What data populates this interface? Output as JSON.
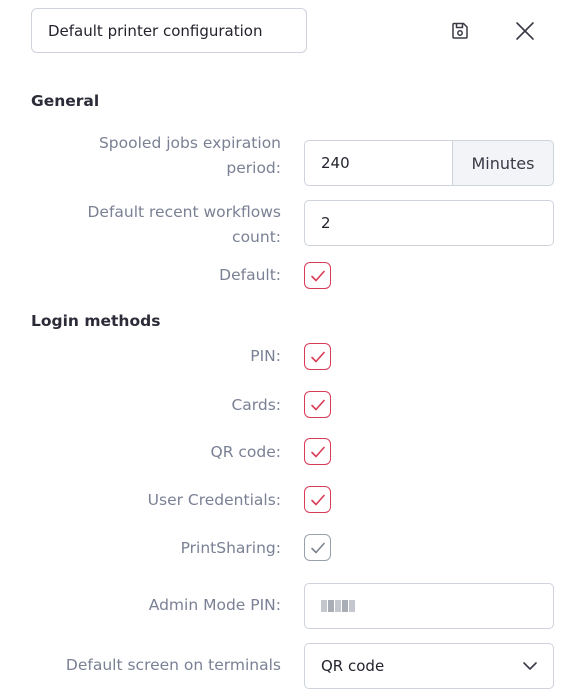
{
  "header": {
    "config_name": "Default printer configuration",
    "save_icon": "floppy-disk",
    "close_icon": "x-mark"
  },
  "general": {
    "title": "General",
    "spool_label_line1": "Spooled jobs expiration",
    "spool_label_line2": "period:",
    "spool_value": "240",
    "spool_unit": "Minutes",
    "recent_label_line1": "Default recent workflows",
    "recent_label_line2": "count:",
    "recent_value": "2",
    "default_label": "Default:",
    "default_checked": true
  },
  "login": {
    "title": "Login methods",
    "methods": [
      {
        "label": "PIN:",
        "checked": true
      },
      {
        "label": "Cards:",
        "checked": true
      },
      {
        "label": "QR code:",
        "checked": true
      },
      {
        "label": "User Credentials:",
        "checked": true
      },
      {
        "label": "PrintSharing:",
        "checked": true
      }
    ],
    "admin_pin_label": "Admin Mode PIN:",
    "default_screen_label": "Default screen on terminals",
    "default_screen_value": "QR code"
  },
  "colors": {
    "accent_red": "#d83b55",
    "neutral_check": "#9aa1ae",
    "label_grey": "#7a8194"
  }
}
